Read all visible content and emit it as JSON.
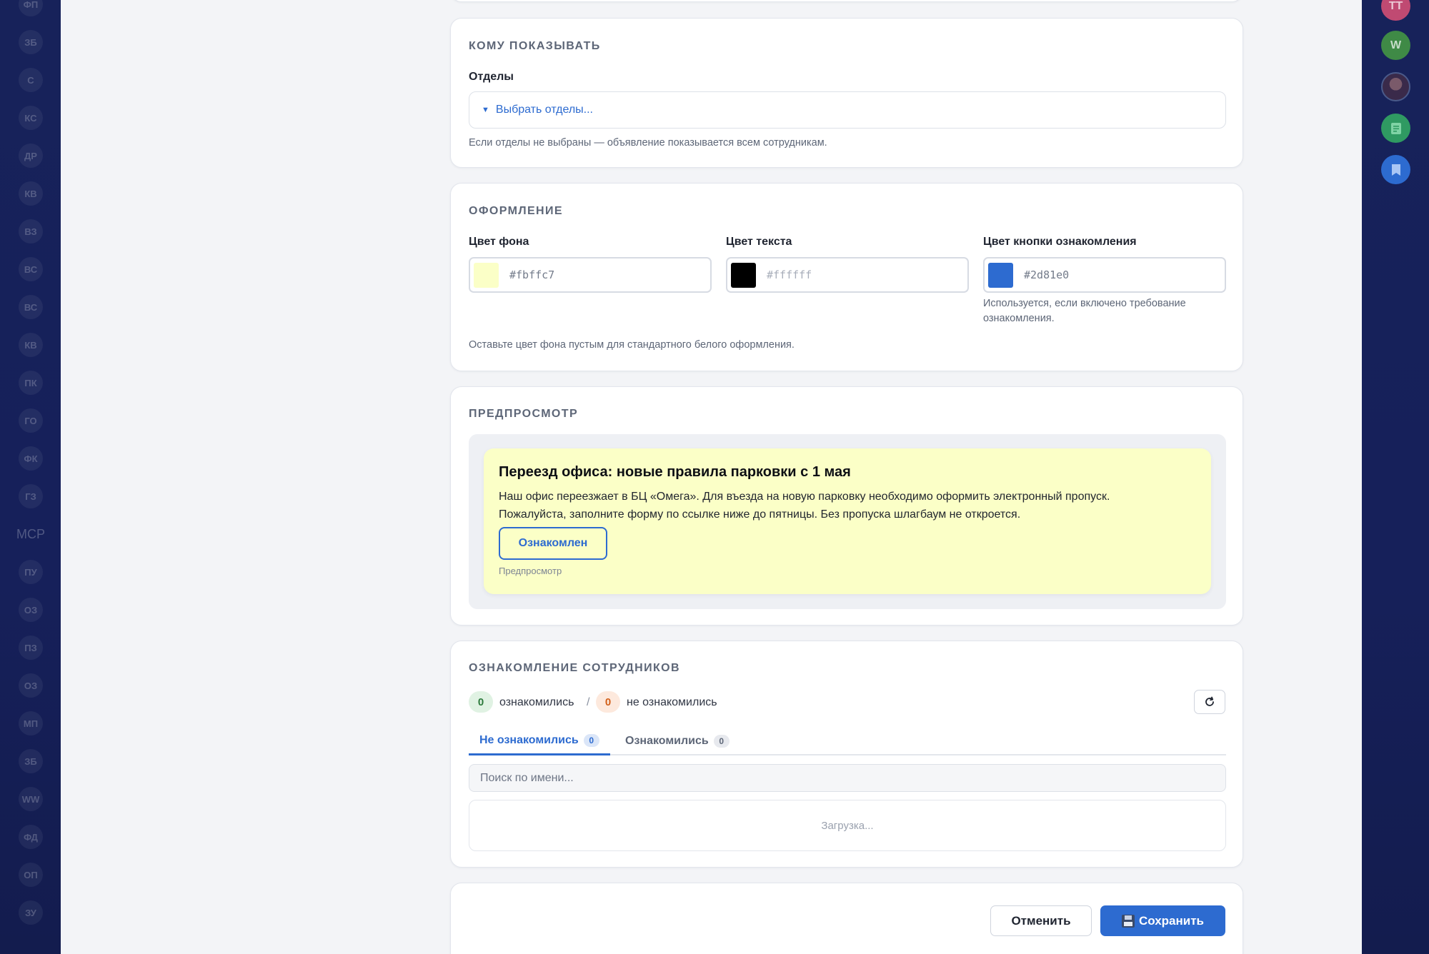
{
  "left_rail": {
    "items": [
      "ФП",
      "ЗБ",
      "С",
      "КС",
      "ДР",
      "КВ",
      "ВЗ",
      "ВС",
      "ВС",
      "КВ",
      "ПК",
      "ГО",
      "ФК",
      "ГЗ",
      "MCP",
      "ПУ",
      "ОЗ",
      "ПЗ",
      "ОЗ",
      "МП",
      "ЗБ",
      "WW",
      "ФД",
      "ОП",
      "ЗУ"
    ]
  },
  "right_rail": {
    "items": [
      {
        "label": "ТТ",
        "icon": "user-avatar-initials",
        "color": "#c04a72"
      },
      {
        "label": "W",
        "icon": "user-avatar-initials",
        "color": "#3f8a46"
      },
      {
        "label": "",
        "icon": "user-avatar-photo",
        "color": "#3a2a4a"
      },
      {
        "label": "",
        "icon": "document-icon",
        "color": "#2f9a62"
      },
      {
        "label": "",
        "icon": "bookmark-icon",
        "color": "#2d6bd0"
      }
    ]
  },
  "audience": {
    "title": "КОМУ ПОКАЗЫВАТЬ",
    "departments_label": "Отделы",
    "departments_placeholder": "Выбрать отделы...",
    "hint": "Если отделы не выбраны — объявление показывается всем сотрудникам."
  },
  "design": {
    "title": "ОФОРМЛЕНИЕ",
    "bg_color_label": "Цвет фона",
    "bg_color_value": "#fbffc7",
    "text_color_label": "Цвет текста",
    "text_color_value": "#ffffff",
    "text_color_swatch": "#000000",
    "button_color_label": "Цвет кнопки ознакомления",
    "button_color_value": "#2d81e0",
    "button_color_swatch": "#2d6bd0",
    "button_color_hint": "Используется, если включено требование ознакомления.",
    "hint": "Оставьте цвет фона пустым для стандартного белого оформления."
  },
  "preview": {
    "title": "ПРЕДПРОСМОТР",
    "announcement_title": "Переезд офиса: новые правила парковки с 1 мая",
    "announcement_body_line1": "Наш офис переезжает в БЦ «Омега». Для въезда на новую парковку необходимо оформить электронный пропуск.",
    "announcement_body_line2": "Пожалуйста, заполните форму по ссылке ниже до пятницы. Без пропуска шлагбаум не откроется.",
    "ack_button": "Ознакомлен",
    "caption": "Предпросмотр"
  },
  "acknowledgement": {
    "title": "ОЗНАКОМЛЕНИЕ СОТРУДНИКОВ",
    "acknowledged_count": "0",
    "acknowledged_label": "ознакомились",
    "separator": "/",
    "not_acknowledged_count": "0",
    "not_acknowledged_label": "не ознакомились",
    "tabs": [
      {
        "label": "Не ознакомились",
        "count": "0",
        "active": true
      },
      {
        "label": "Ознакомились",
        "count": "0",
        "active": false
      }
    ],
    "search_placeholder": "Поиск по имени...",
    "loading_text": "Загрузка..."
  },
  "footer": {
    "cancel_label": "Отменить",
    "save_label": "Сохранить"
  }
}
